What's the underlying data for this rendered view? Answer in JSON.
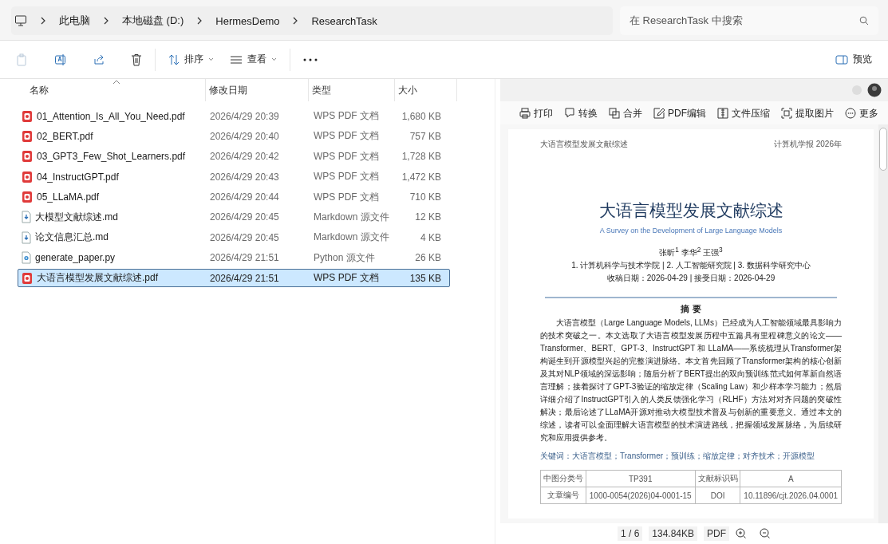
{
  "address_bar": {
    "crumbs": [
      "此电脑",
      "本地磁盘 (D:)",
      "HermesDemo",
      "ResearchTask"
    ]
  },
  "search": {
    "placeholder": "在 ResearchTask 中搜索"
  },
  "command_bar": {
    "sort": "排序",
    "view": "查看",
    "preview": "预览"
  },
  "file_list": {
    "columns": [
      {
        "label": "名称",
        "sorted": true
      },
      {
        "label": "修改日期",
        "sorted": false
      },
      {
        "label": "类型",
        "sorted": false
      },
      {
        "label": "大小",
        "sorted": false
      }
    ],
    "rows": [
      {
        "kind": "pdf",
        "name": "01_Attention_Is_All_You_Need.pdf",
        "modified": "2026/4/29 20:39",
        "type": "WPS PDF 文档",
        "size": "1,680 KB",
        "selected": false
      },
      {
        "kind": "pdf",
        "name": "02_BERT.pdf",
        "modified": "2026/4/29 20:40",
        "type": "WPS PDF 文档",
        "size": "757 KB",
        "selected": false
      },
      {
        "kind": "pdf",
        "name": "03_GPT3_Few_Shot_Learners.pdf",
        "modified": "2026/4/29 20:42",
        "type": "WPS PDF 文档",
        "size": "1,728 KB",
        "selected": false
      },
      {
        "kind": "pdf",
        "name": "04_InstructGPT.pdf",
        "modified": "2026/4/29 20:43",
        "type": "WPS PDF 文档",
        "size": "1,472 KB",
        "selected": false
      },
      {
        "kind": "pdf",
        "name": "05_LLaMA.pdf",
        "modified": "2026/4/29 20:44",
        "type": "WPS PDF 文档",
        "size": "710 KB",
        "selected": false
      },
      {
        "kind": "markdown",
        "name": "大模型文献综述.md",
        "modified": "2026/4/29 20:45",
        "type": "Markdown 源文件",
        "size": "12 KB",
        "selected": false
      },
      {
        "kind": "markdown",
        "name": "论文信息汇总.md",
        "modified": "2026/4/29 20:45",
        "type": "Markdown 源文件",
        "size": "4 KB",
        "selected": false
      },
      {
        "kind": "python",
        "name": "generate_paper.py",
        "modified": "2026/4/29 21:51",
        "type": "Python 源文件",
        "size": "26 KB",
        "selected": false
      },
      {
        "kind": "pdf",
        "name": "大语言模型发展文献综述.pdf",
        "modified": "2026/4/29 21:51",
        "type": "WPS PDF 文档",
        "size": "135 KB",
        "selected": true
      }
    ]
  },
  "preview": {
    "tools": [
      {
        "kind": "print",
        "label": "打印"
      },
      {
        "kind": "convert",
        "label": "转换"
      },
      {
        "kind": "merge",
        "label": "合并"
      },
      {
        "kind": "edit",
        "label": "PDF编辑"
      },
      {
        "kind": "compress",
        "label": "文件压缩"
      },
      {
        "kind": "extract",
        "label": "提取图片"
      },
      {
        "kind": "more",
        "label": "更多"
      }
    ],
    "document": {
      "running_head_left": "大语言模型发展文献综述",
      "running_head_right": "计算机学报 2026年",
      "title": "大语言模型发展文献综述",
      "subtitle": "A Survey on the Development of Large Language Models",
      "authors": "张昕$^{1}$  李华$^{2}$  王强$^{3}$",
      "affiliations": "1. 计算机科学与技术学院 | 2. 人工智能研究院 | 3. 数据科学研究中心",
      "dates": "收稿日期：2026-04-29 | 接受日期：2026-04-29",
      "abstract_heading": "摘 要",
      "abstract": "大语言模型（Large Language Models, LLMs）已经成为人工智能领域最具影响力的技术突破之一。本文选取了大语言模型发展历程中五篇具有里程碑意义的论文——Transformer、BERT、GPT-3、InstructGPT 和 LLaMA——系统梳理从Transformer架构诞生到开源模型兴起的完整演进脉络。本文首先回顾了Transformer架构的核心创新及其对NLP领域的深远影响；随后分析了BERT提出的双向预训练范式如何革新自然语言理解；接着探讨了GPT-3验证的缩放定律（Scaling Law）和少样本学习能力；然后详细介绍了InstructGPT引入的人类反馈强化学习（RLHF）方法对对齐问题的突破性解决；最后论述了LLaMA开源对推动大模型技术普及与创新的重要意义。通过本文的综述，读者可以全面理解大语言模型的技术演进路线，把握领域发展脉络，为后续研究和应用提供参考。",
      "keywords": "关键词：大语言模型；Transformer；预训练；缩放定律；对齐技术；开源模型",
      "info_table": [
        [
          "中图分类号",
          "TP391",
          "文献标识码",
          "A"
        ],
        [
          "文章编号",
          "1000-0054(2026)04-0001-15",
          "DOI",
          "10.11896/cjt.2026.04.0001"
        ]
      ]
    },
    "footer": {
      "page": "1 / 6",
      "size": "134.84KB",
      "format": "PDF"
    }
  }
}
